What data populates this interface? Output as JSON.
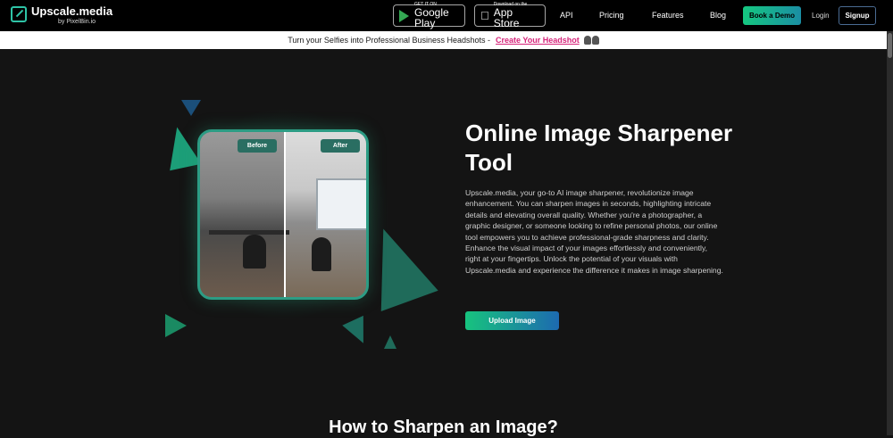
{
  "nav": {
    "logo_title": "Upscale.media",
    "logo_sub": "by PixelBin.io",
    "google_play_small": "GET IT ON",
    "google_play_big": "Google Play",
    "app_store_small": "Download on the",
    "app_store_big": "App Store",
    "links": [
      "API",
      "Pricing",
      "Features",
      "Blog"
    ],
    "book_demo": "Book a Demo",
    "login": "Login",
    "signup": "Signup"
  },
  "banner": {
    "text": "Turn your Selfies into Professional Business Headshots -",
    "link": "Create Your Headshot"
  },
  "hero": {
    "before_tag": "Before",
    "after_tag": "After",
    "title": "Online Image Sharpener Tool",
    "description": "Upscale.media, your go-to AI image sharpener, revolutionize image enhancement. You can sharpen images in seconds, highlighting intricate details and elevating overall quality. Whether you're a photographer, a graphic designer, or someone looking to refine personal photos, our online tool empowers you to achieve professional-grade sharpness and clarity. Enhance the visual impact of your images effortlessly and conveniently, right at your fingertips. Unlock the potential of your visuals with Upscale.media and experience the difference it makes in image sharpening.",
    "upload_button": "Upload Image"
  },
  "section": {
    "title": "How to Sharpen an Image?"
  },
  "colors": {
    "accent_green": "#15c780",
    "accent_blue": "#1d6ab0",
    "banner_link": "#d6247a",
    "background": "#141414"
  }
}
